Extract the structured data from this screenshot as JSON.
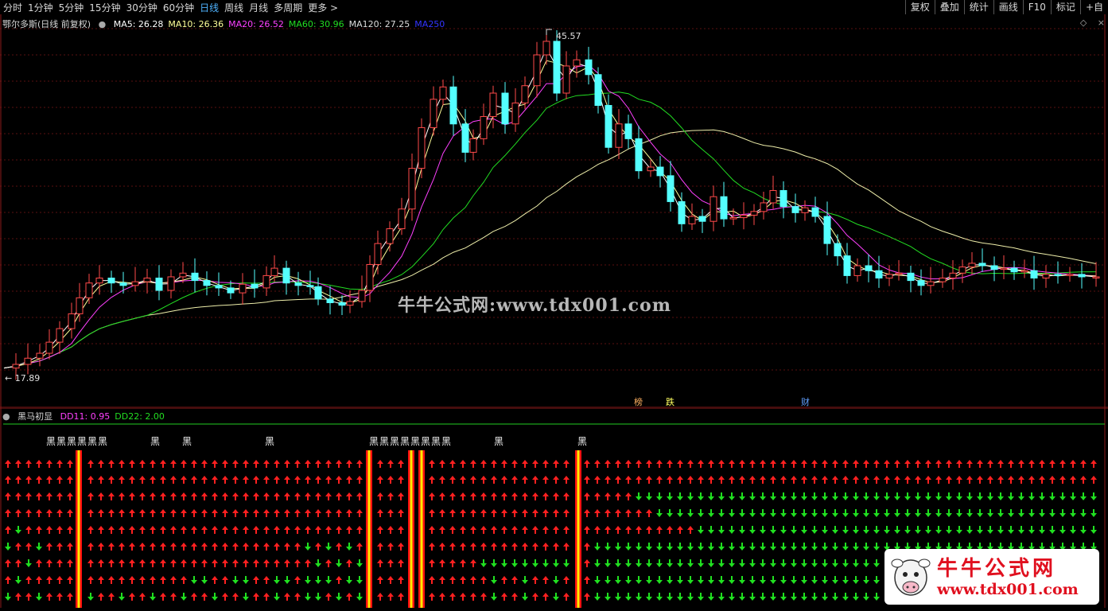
{
  "toolbar": {
    "periods": [
      "分时",
      "1分钟",
      "5分钟",
      "15分钟",
      "30分钟",
      "60分钟",
      "日线",
      "周线",
      "月线",
      "多周期",
      "更多 >"
    ],
    "active_period": "日线",
    "right_buttons": [
      "复权",
      "叠加",
      "统计",
      "画线",
      "F10",
      "标记",
      "+自"
    ]
  },
  "main_chart": {
    "title": "鄂尔多斯(日线 前复权)",
    "indicators": [
      {
        "label": "MA5: 26.28",
        "color": "#ffffff"
      },
      {
        "label": "MA10: 26.36",
        "color": "#ffff99"
      },
      {
        "label": "MA20: 26.52",
        "color": "#ff40ff"
      },
      {
        "label": "MA60: 30.96",
        "color": "#22dd22"
      },
      {
        "label": "MA120: 27.25",
        "color": "#dddddd"
      },
      {
        "label": "MA250",
        "color": "#3333ff"
      }
    ],
    "high_label": "45.57",
    "low_label": "← 17.89",
    "markers": [
      {
        "label": "榜",
        "color": "#ffb060"
      },
      {
        "label": "跌",
        "color": "#ffff60"
      },
      {
        "label": "财",
        "color": "#60a0ff"
      }
    ]
  },
  "sub_chart": {
    "title": "黑马初显",
    "indicators": [
      {
        "label": "DD11: 0.95",
        "color": "#ff40ff"
      },
      {
        "label": "DD22: 2.00",
        "color": "#22dd22"
      }
    ],
    "signal_char": "黑"
  },
  "watermark": "牛牛公式网:www.tdx001.com",
  "logo": {
    "title": "牛牛公式网",
    "url": "www.tdx001.com"
  },
  "chart_data": {
    "type": "candlestick",
    "title": "鄂尔多斯(日线 前复权)",
    "price_high": 45.57,
    "price_low": 17.89,
    "moving_averages": {
      "MA5": 26.28,
      "MA10": 26.36,
      "MA20": 26.52,
      "MA60": 30.96,
      "MA120": 27.25
    },
    "colors": {
      "up": "#ff4a4a",
      "down": "#54ffff",
      "ma5": "#ffffff",
      "ma10": "#ffff99",
      "ma20": "#ff40ff",
      "ma60": "#22dd22",
      "ma120": "#eeeeaa"
    }
  }
}
